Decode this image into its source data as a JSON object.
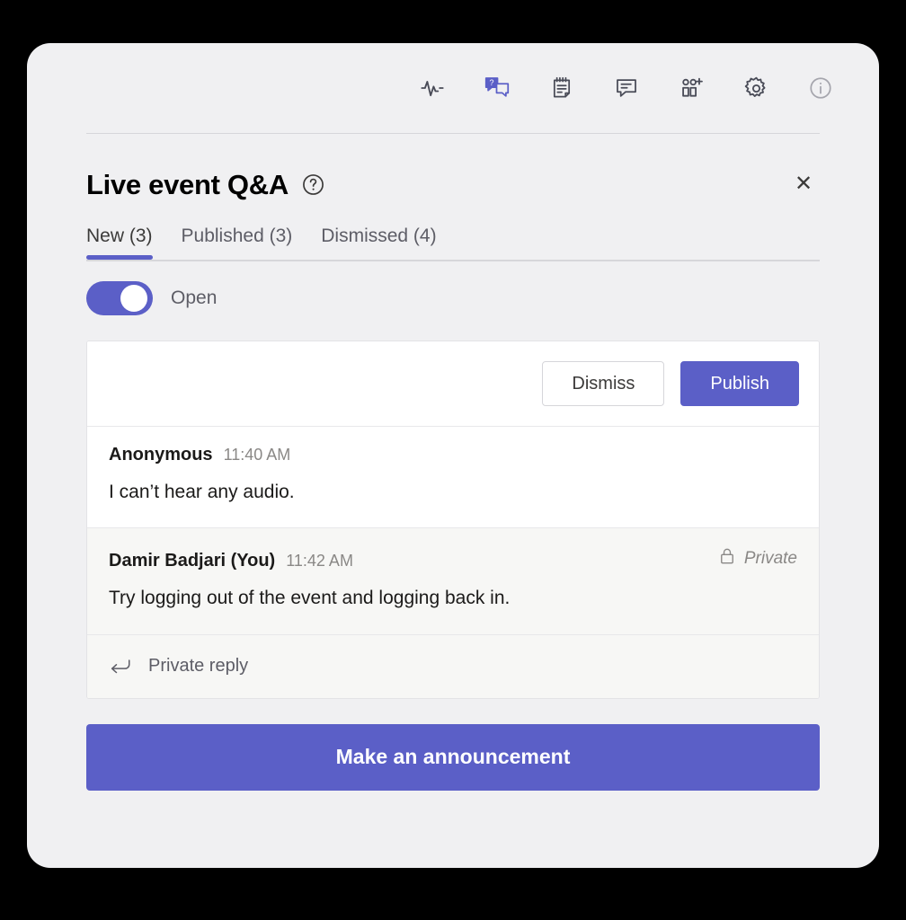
{
  "toolbar": {
    "items": [
      {
        "name": "health-pulse-icon",
        "label": "Health",
        "state": "default"
      },
      {
        "name": "qna-icon",
        "label": "Q&A",
        "state": "active"
      },
      {
        "name": "notes-icon",
        "label": "Notes",
        "state": "default"
      },
      {
        "name": "chat-icon",
        "label": "Chat",
        "state": "default"
      },
      {
        "name": "add-people-icon",
        "label": "Add people",
        "state": "default"
      },
      {
        "name": "gear-icon",
        "label": "Settings",
        "state": "default"
      },
      {
        "name": "info-icon",
        "label": "Info",
        "state": "muted"
      }
    ]
  },
  "header": {
    "title": "Live event Q&A",
    "help_icon": "question-mark-circle-icon",
    "close_icon": "close-icon",
    "close_label": "✕"
  },
  "tabs": [
    {
      "label": "New (3)",
      "active": true
    },
    {
      "label": "Published (3)",
      "active": false
    },
    {
      "label": "Dismissed (4)",
      "active": false
    }
  ],
  "toggle": {
    "label": "Open",
    "on": true
  },
  "card": {
    "actions": {
      "dismiss_label": "Dismiss",
      "publish_label": "Publish"
    },
    "messages": [
      {
        "author": "Anonymous",
        "time": "11:40 AM",
        "text": "I can’t hear any audio.",
        "flag": "",
        "flag_icon": ""
      },
      {
        "author": "Damir Badjari (You)",
        "time": "11:42 AM",
        "text": "Try logging out of the event and logging back in.",
        "flag": "Private",
        "flag_icon": "lock-icon"
      }
    ],
    "reply": {
      "label": "Private reply",
      "icon": "reply-arrow-icon"
    }
  },
  "announcement": {
    "label": "Make an announcement"
  },
  "colors": {
    "brand_purple": "#5b5fc7",
    "panel_bg": "#f0f0f2",
    "card_bg": "#ffffff",
    "reply_bg": "#f7f7f5",
    "page_bg": "#000000"
  }
}
